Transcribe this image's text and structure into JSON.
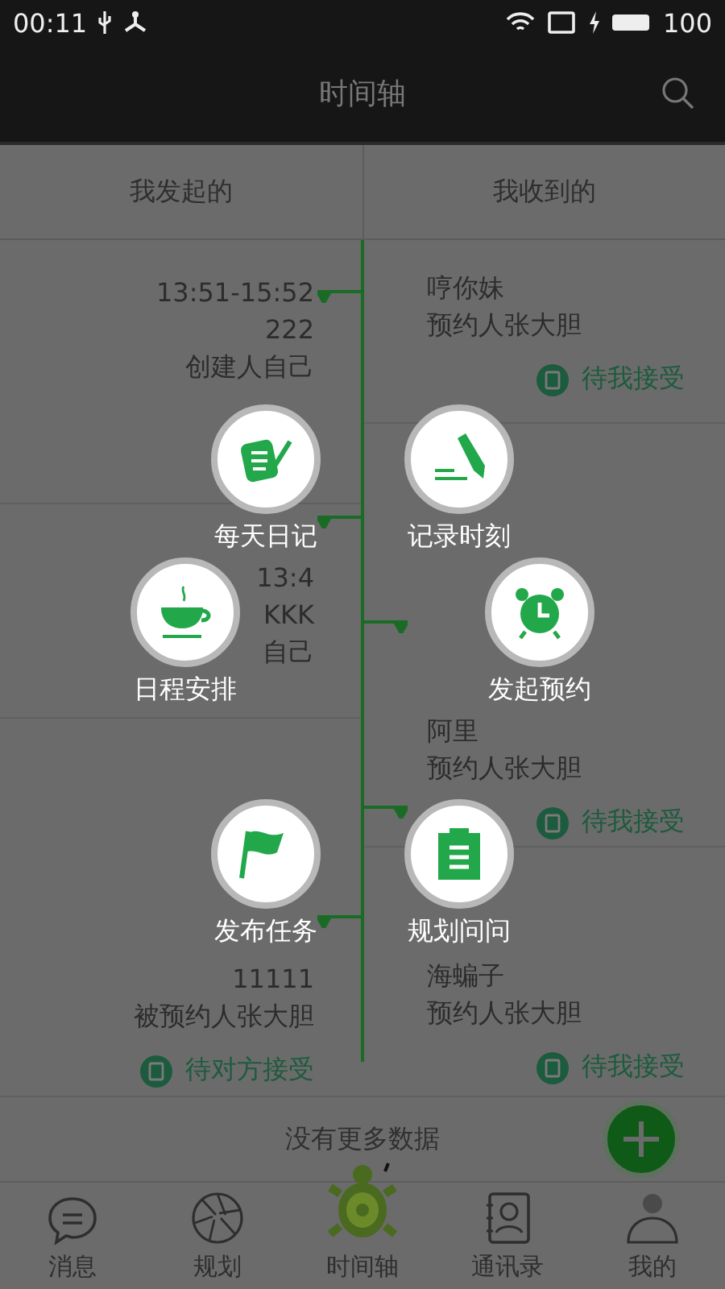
{
  "status_bar": {
    "time": "00:11",
    "battery": "100"
  },
  "header": {
    "title": "时间轴"
  },
  "tabs": [
    {
      "label": "我发起的"
    },
    {
      "label": "我收到的"
    }
  ],
  "sent": [
    {
      "time": "13:51-15:52",
      "title": "222",
      "person": "创建人自己"
    },
    {
      "time": "13:4",
      "title": "KKK",
      "person": "自己"
    },
    {
      "title": "11111",
      "person": "被预约人张大胆",
      "status": "待对方接受"
    }
  ],
  "received": [
    {
      "title": "哼你妹",
      "person": "预约人张大胆",
      "status": "待我接受"
    },
    {
      "title": "阿里",
      "person": "预约人张大胆",
      "status": "待我接受"
    },
    {
      "title": "海蝙子",
      "person": "预约人张大胆",
      "status": "待我接受"
    }
  ],
  "footer": "没有更多数据",
  "quick_menu": [
    {
      "kind": "diary",
      "label": "每天日记"
    },
    {
      "kind": "pencil",
      "label": "记录时刻"
    },
    {
      "kind": "cup",
      "label": "日程安排"
    },
    {
      "kind": "alarm",
      "label": "发起预约"
    },
    {
      "kind": "flag",
      "label": "发布任务"
    },
    {
      "kind": "clipboard",
      "label": "规划问问"
    }
  ],
  "nav": [
    {
      "kind": "chat",
      "label": "消息",
      "selected": false
    },
    {
      "kind": "aperture",
      "label": "规划",
      "selected": false
    },
    {
      "kind": "turtle",
      "label": "时间轴",
      "selected": true
    },
    {
      "kind": "contacts",
      "label": "通讯录",
      "selected": false
    },
    {
      "kind": "person",
      "label": "我的",
      "selected": false
    }
  ]
}
